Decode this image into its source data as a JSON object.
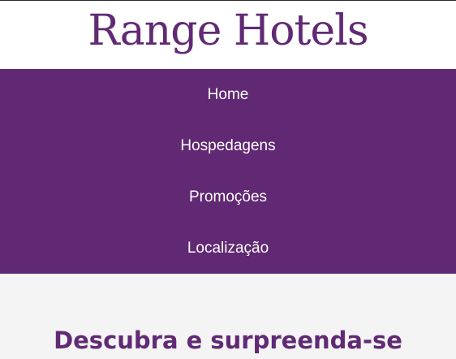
{
  "brand": {
    "logo_text": "Range Hotels",
    "accent_color": "#612873"
  },
  "nav": {
    "items": [
      {
        "label": "Home"
      },
      {
        "label": "Hospedagens"
      },
      {
        "label": "Promoções"
      },
      {
        "label": "Localização"
      }
    ]
  },
  "main": {
    "heading": "Descubra e surpreenda-se"
  }
}
